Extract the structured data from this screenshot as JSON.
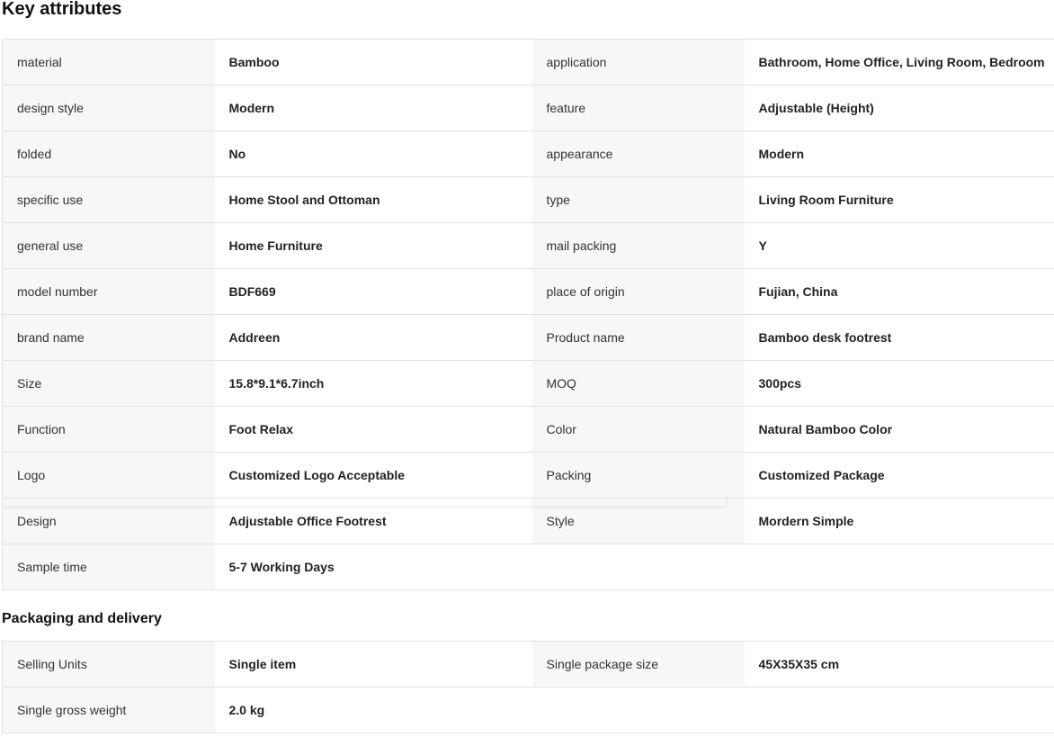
{
  "key_attributes": {
    "title": "Key attributes",
    "rows": [
      [
        "material",
        "Bamboo",
        "application",
        "Bathroom, Home Office, Living Room, Bedroom"
      ],
      [
        "design style",
        "Modern",
        "feature",
        "Adjustable (Height)"
      ],
      [
        "folded",
        "No",
        "appearance",
        "Modern"
      ],
      [
        "specific use",
        "Home Stool and Ottoman",
        "type",
        "Living Room Furniture"
      ],
      [
        "general use",
        "Home Furniture",
        "mail packing",
        "Y"
      ],
      [
        "model number",
        "BDF669",
        "place of origin",
        "Fujian, China"
      ],
      [
        "brand name",
        "Addreen",
        "Product name",
        "Bamboo desk footrest"
      ],
      [
        "Size",
        "15.8*9.1*6.7inch",
        "MOQ",
        "300pcs"
      ],
      [
        "Function",
        "Foot Relax",
        "Color",
        "Natural Bamboo Color"
      ],
      [
        "Logo",
        "Customized Logo Acceptable",
        "Packing",
        "Customized Package"
      ],
      [
        "Design",
        "Adjustable Office Footrest",
        "Style",
        "Mordern Simple"
      ],
      [
        "Sample time",
        "5-7 Working Days",
        "",
        ""
      ]
    ]
  },
  "packaging_delivery": {
    "title": "Packaging and delivery",
    "rows": [
      [
        "Selling Units",
        "Single item",
        "Single package size",
        "45X35X35 cm"
      ],
      [
        "Single gross weight",
        "2.0 kg",
        "",
        ""
      ]
    ]
  },
  "colors": {
    "label_bg": "#f7f7f7",
    "value_bg": "#ffffff",
    "border": "#e2e2e2",
    "title_text": "#111111",
    "body_text": "#222222"
  }
}
